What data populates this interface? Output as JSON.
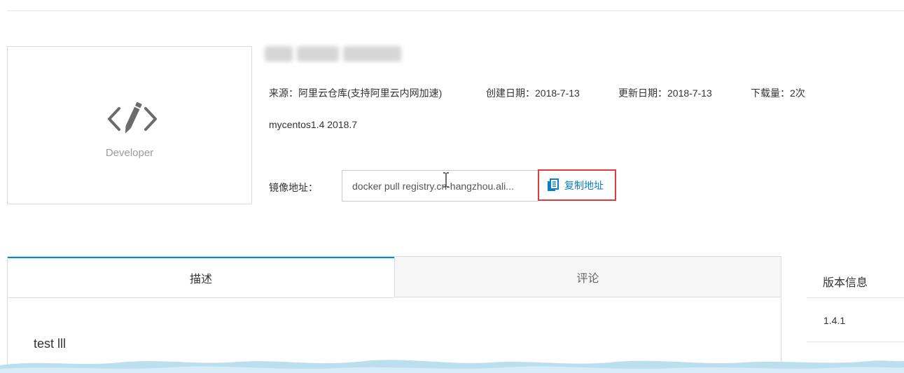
{
  "logo": {
    "text": "Developer",
    "icon": "code-pencil-icon"
  },
  "meta": {
    "source": "来源：阿里云仓库(支持阿里云内网加速)",
    "created": "创建日期：2018-7-13",
    "updated": "更新日期：2018-7-13",
    "downloads": "下载量：2次"
  },
  "description_line": "mycentos1.4 2018.7",
  "address": {
    "label": "镜像地址：",
    "value": "docker pull registry.cn-hangzhou.ali...",
    "copy_label": "复制地址",
    "copy_icon": "copy-icon"
  },
  "tabs": [
    {
      "label": "描述",
      "active": true
    },
    {
      "label": "评论",
      "active": false
    }
  ],
  "panel_text": "test lll",
  "version": {
    "title": "版本信息",
    "items": [
      "1.4.1"
    ]
  },
  "colors": {
    "accent": "#0a7ec8",
    "highlight_border": "#e03a3a",
    "tab_active_border": "#0a86d1"
  }
}
